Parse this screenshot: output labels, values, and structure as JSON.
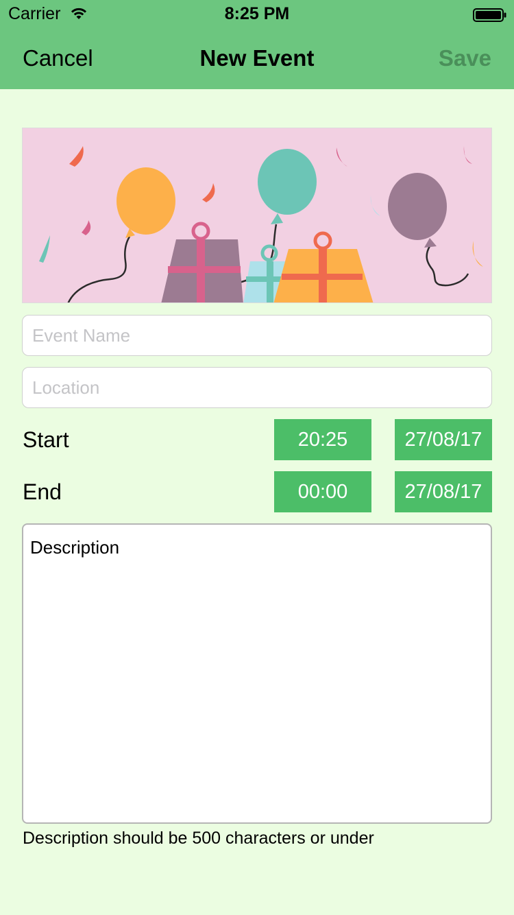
{
  "status_bar": {
    "carrier": "Carrier",
    "time": "8:25 PM"
  },
  "nav": {
    "cancel_label": "Cancel",
    "title": "New Event",
    "save_label": "Save"
  },
  "banner": {
    "image": "party-banner-balloons-gifts",
    "background_color": "#f2d0e2"
  },
  "form": {
    "event_name": {
      "placeholder": "Event Name",
      "value": ""
    },
    "location": {
      "placeholder": "Location",
      "value": ""
    },
    "start": {
      "label": "Start",
      "time": "20:25",
      "date": "27/08/17"
    },
    "end": {
      "label": "End",
      "time": "00:00",
      "date": "27/08/17"
    },
    "description": {
      "value": "Description"
    },
    "helper_text": "Description should be 500 characters or under"
  },
  "colors": {
    "header": "#6cc67f",
    "page_background": "#ebfde1",
    "accent_button": "#4cbe68",
    "save_disabled": "#4a8f5a"
  },
  "icons": [
    "wifi-icon",
    "battery-icon"
  ]
}
